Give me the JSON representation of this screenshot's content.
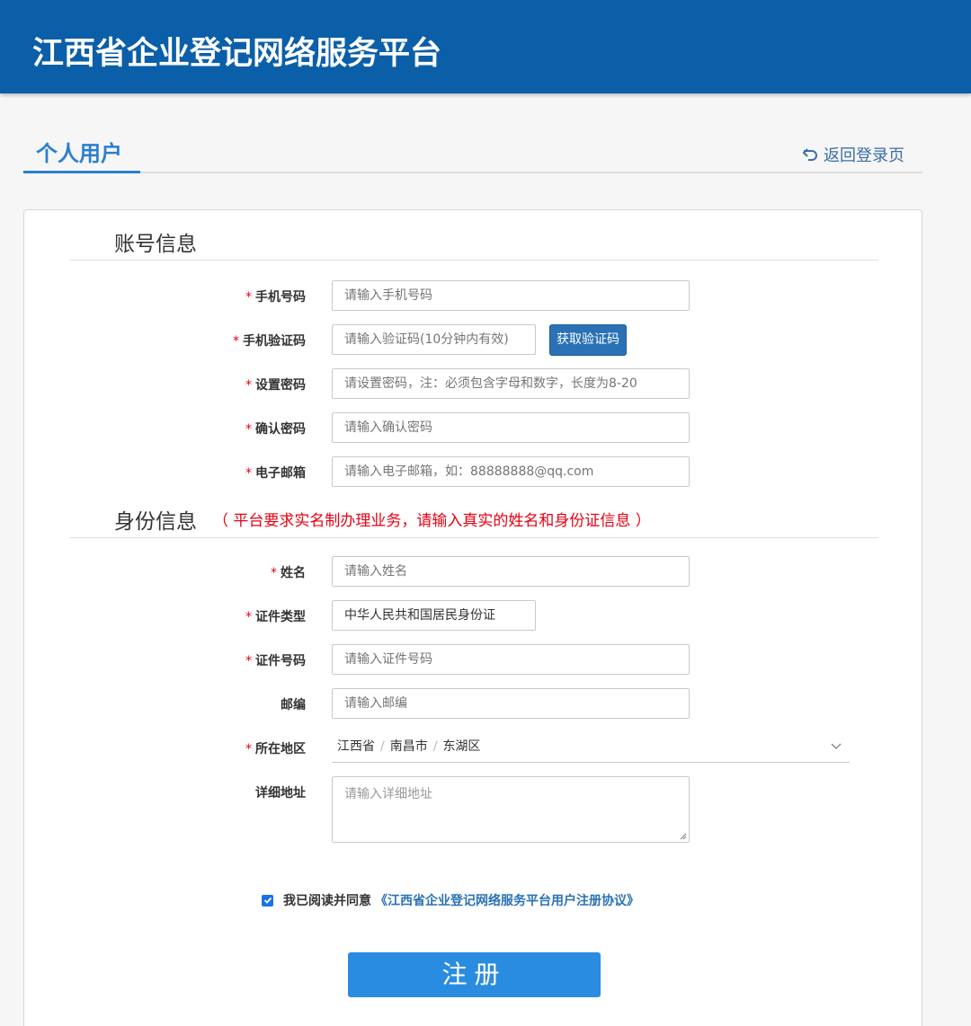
{
  "header": {
    "title": "江西省企业登记网络服务平台"
  },
  "tabs": {
    "active_label": "个人用户",
    "back_label": "返回登录页"
  },
  "account_section": {
    "title": "账号信息",
    "fields": {
      "phone": {
        "label": "手机号码",
        "required": "*",
        "placeholder": "请输入手机号码"
      },
      "code": {
        "label": "手机验证码",
        "required": "*",
        "placeholder": "请输入验证码(10分钟内有效)",
        "button": "获取验证码"
      },
      "password": {
        "label": "设置密码",
        "required": "*",
        "placeholder": "请设置密码，注：必须包含字母和数字，长度为8-20"
      },
      "confirm": {
        "label": "确认密码",
        "required": "*",
        "placeholder": "请输入确认密码"
      },
      "email": {
        "label": "电子邮箱",
        "required": "*",
        "placeholder": "请输入电子邮箱，如：88888888@qq.com"
      }
    }
  },
  "identity_section": {
    "title": "身份信息",
    "note": "（ 平台要求实名制办理业务，请输入真实的姓名和身份证信息 ）",
    "fields": {
      "name": {
        "label": "姓名",
        "required": "*",
        "placeholder": "请输入姓名"
      },
      "id_type": {
        "label": "证件类型",
        "required": "*",
        "value": "中华人民共和国居民身份证"
      },
      "id_number": {
        "label": "证件号码",
        "required": "*",
        "placeholder": "请输入证件号码"
      },
      "postcode": {
        "label": "邮编",
        "placeholder": "请输入邮编"
      },
      "region": {
        "label": "所在地区",
        "required": "*",
        "province": "江西省",
        "city": "南昌市",
        "district": "东湖区",
        "separator": "/"
      },
      "address": {
        "label": "详细地址",
        "placeholder": "请输入详细地址"
      }
    }
  },
  "agreement": {
    "checked": true,
    "text": "我已阅读并同意",
    "link": "《江西省企业登记网络服务平台用户注册协议》"
  },
  "submit": {
    "label": "注册"
  },
  "colors": {
    "header_bg": "#0b5fa8",
    "accent": "#2a7fd0",
    "required": "#e60012",
    "button": "#2a8ce0"
  }
}
